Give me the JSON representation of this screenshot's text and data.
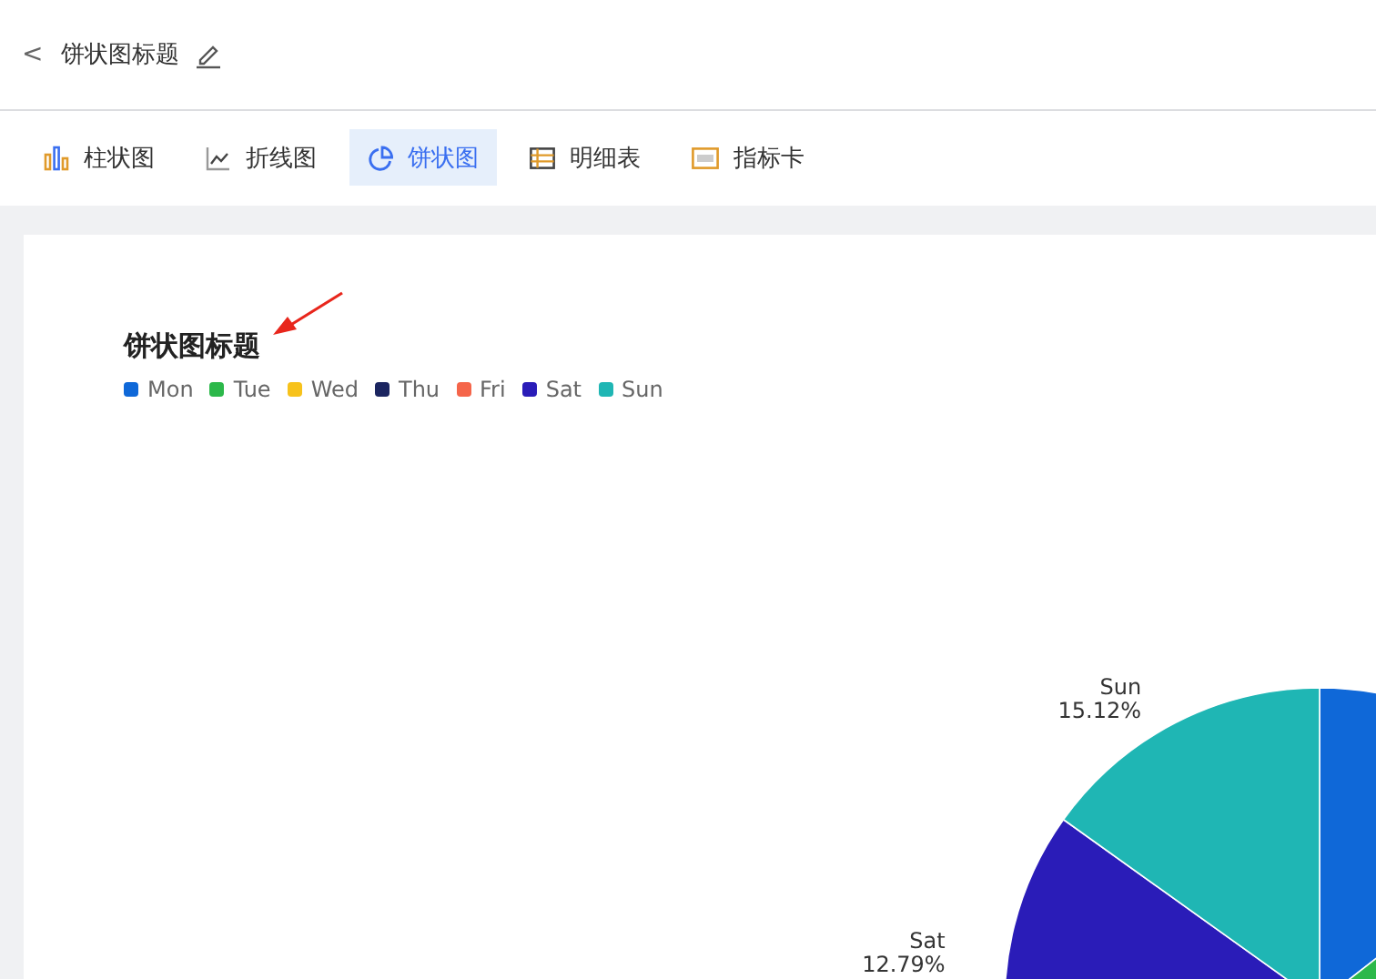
{
  "header": {
    "back": "<",
    "title": "饼状图标题"
  },
  "tabs": [
    {
      "label": "柱状图",
      "kind": "bar",
      "selected": false
    },
    {
      "label": "折线图",
      "kind": "line",
      "selected": false
    },
    {
      "label": "饼状图",
      "kind": "pie",
      "selected": true
    },
    {
      "label": "明细表",
      "kind": "table",
      "selected": false
    },
    {
      "label": "指标卡",
      "kind": "card",
      "selected": false
    }
  ],
  "chart": {
    "title": "饼状图标题",
    "legend": [
      {
        "label": "Mon",
        "color": "#0f68d8"
      },
      {
        "label": "Tue",
        "color": "#2cb84a"
      },
      {
        "label": "Wed",
        "color": "#f7c21b"
      },
      {
        "label": "Thu",
        "color": "#1b2560"
      },
      {
        "label": "Fri",
        "color": "#f5654a"
      },
      {
        "label": "Sat",
        "color": "#2a1cb8",
        "slice_label": {
          "name": "Sat",
          "percent": "12.79%"
        }
      },
      {
        "label": "Sun",
        "color": "#1fb6b4",
        "slice_label": {
          "name": "Sun",
          "percent": "15.12%"
        }
      }
    ]
  }
}
